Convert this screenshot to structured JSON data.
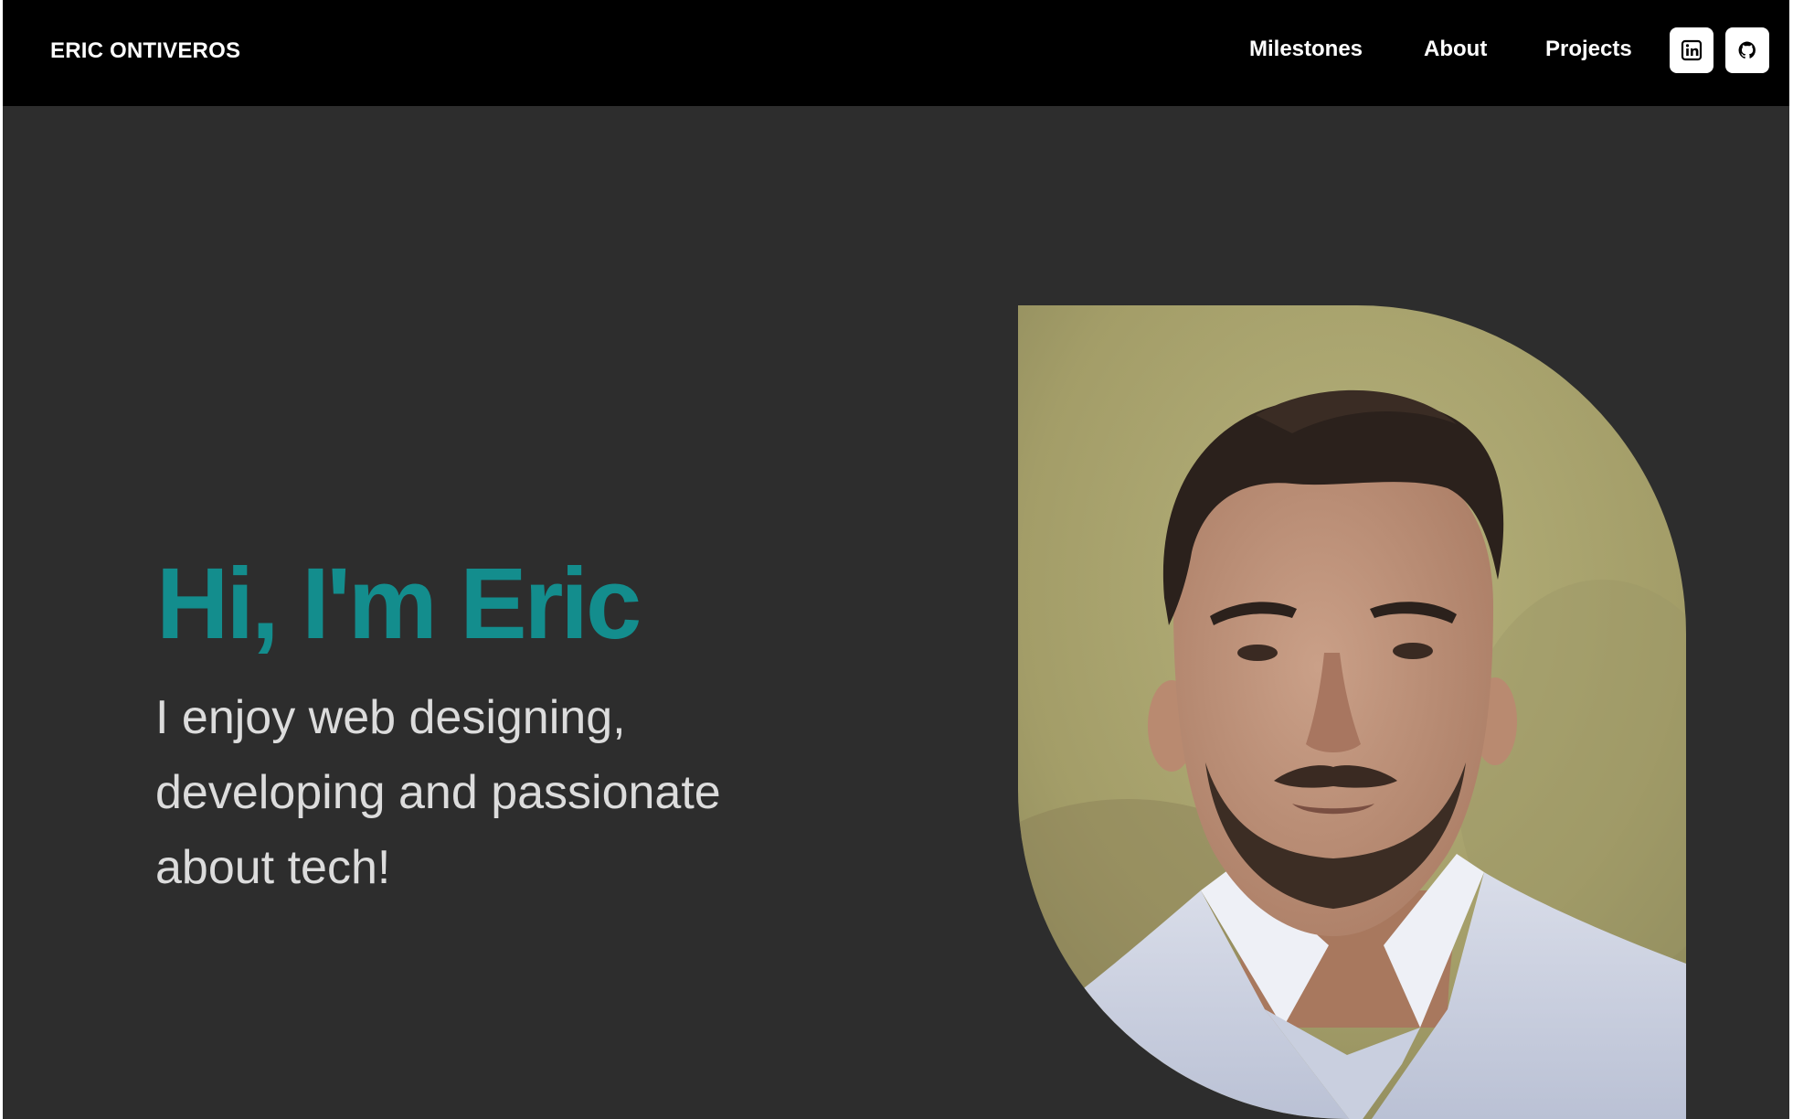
{
  "nav": {
    "brand": "ERIC ONTIVEROS",
    "links": [
      {
        "label": "Milestones"
      },
      {
        "label": "About"
      },
      {
        "label": "Projects"
      }
    ],
    "social": [
      {
        "icon": "linkedin-icon"
      },
      {
        "icon": "github-icon"
      }
    ]
  },
  "hero": {
    "title": "Hi, I'm Eric",
    "subtitle": "I enjoy web designing, developing and passionate about tech!"
  },
  "colors": {
    "navbar_bg": "#000000",
    "page_bg": "#2d2d2d",
    "accent": "#138d8d",
    "subtitle_text": "#dcdcdc"
  }
}
